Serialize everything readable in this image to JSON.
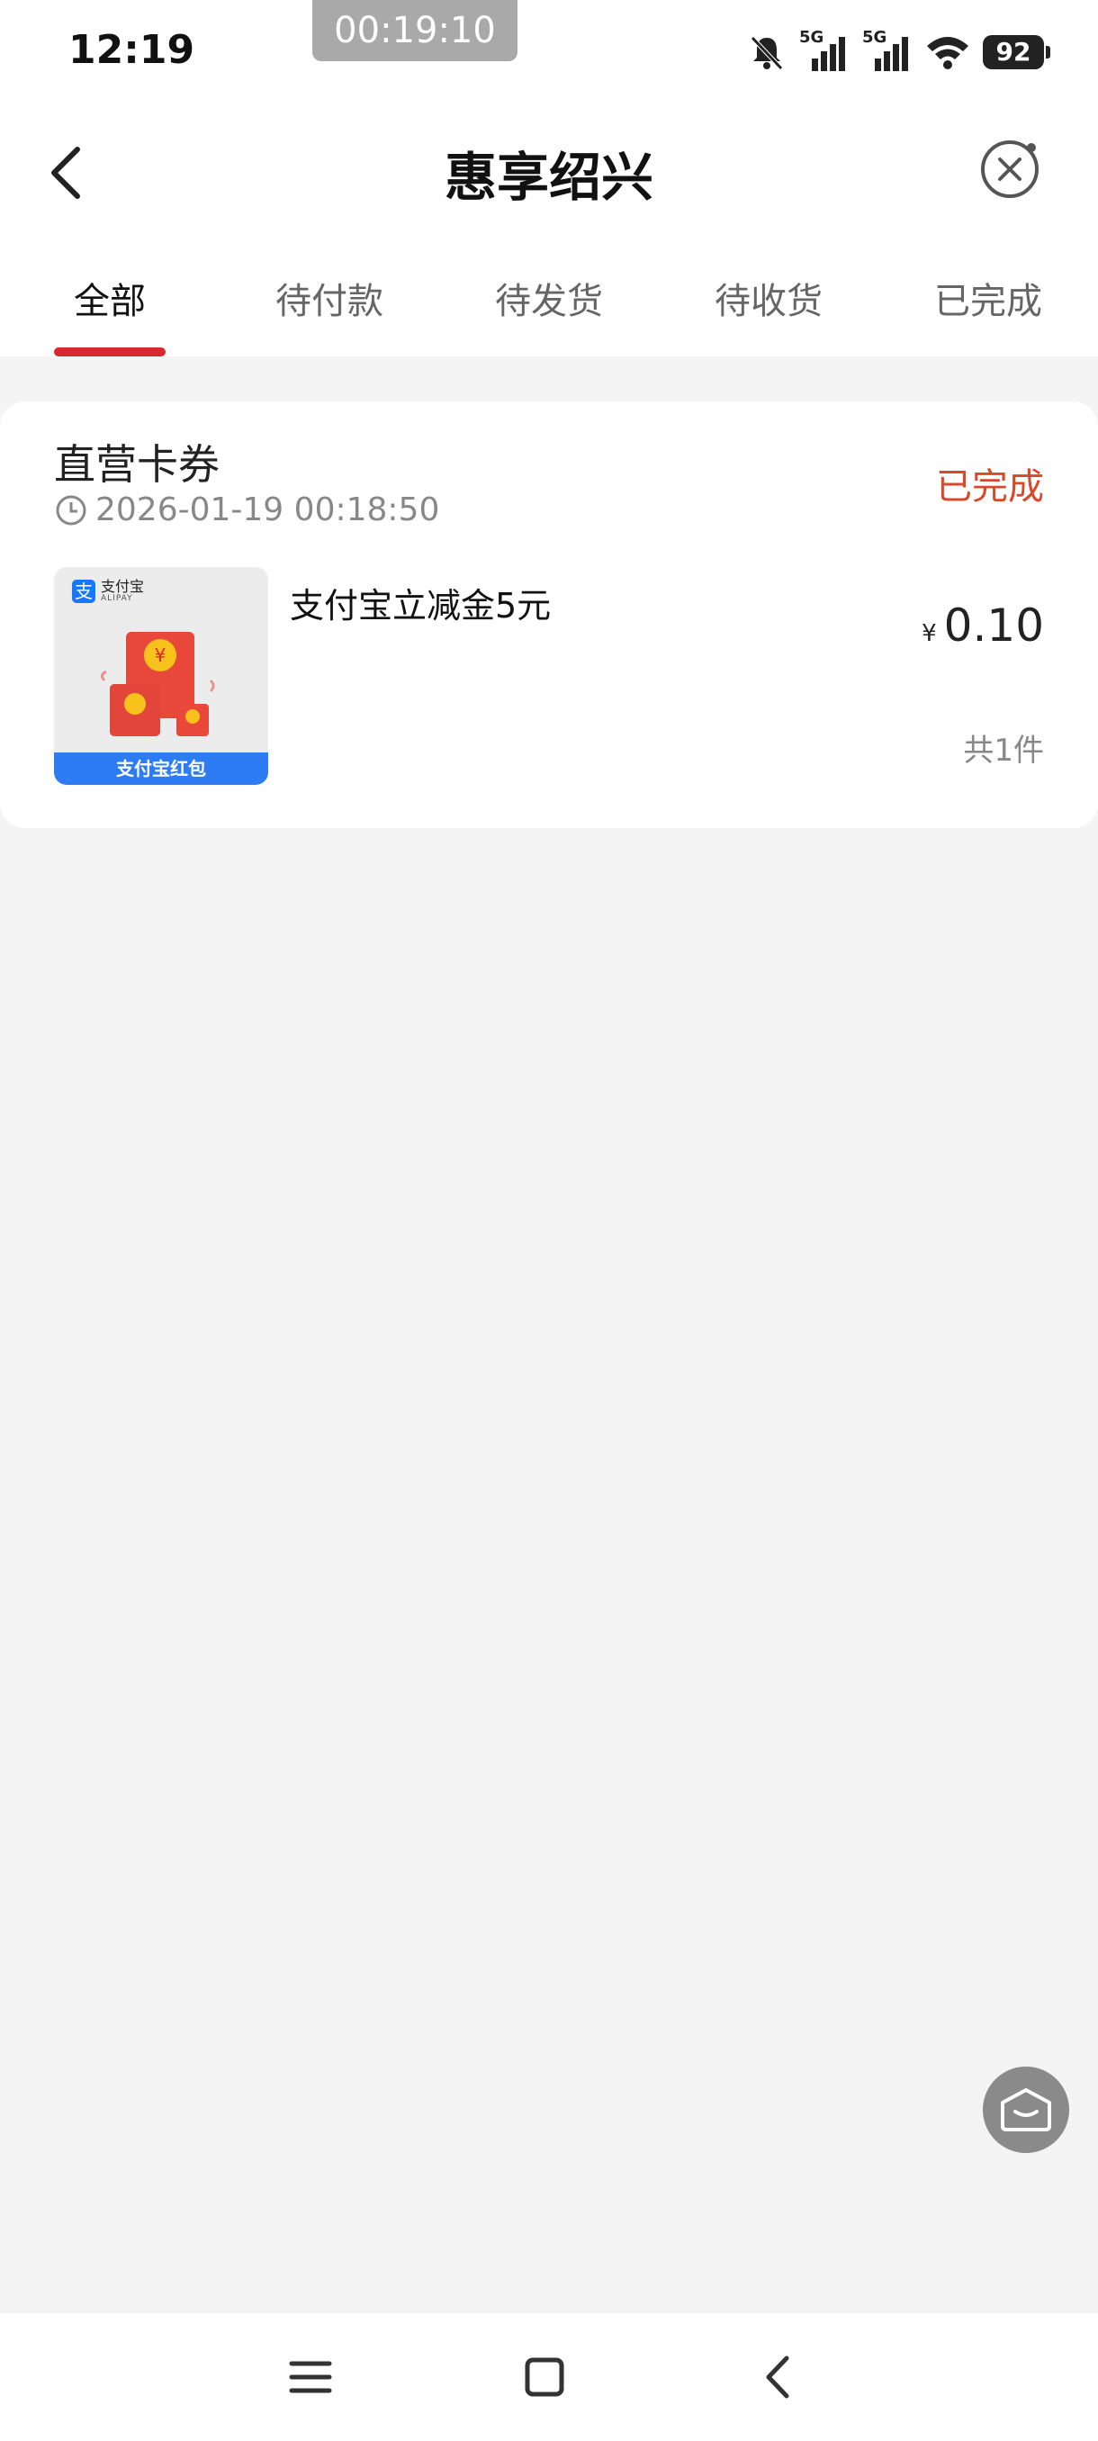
{
  "status_bar": {
    "time": "12:19",
    "recorder": "00:19:10",
    "battery": "92",
    "signal_label_1": "5G",
    "signal_label_2": "5G"
  },
  "header": {
    "title": "惠享绍兴",
    "back_icon": "back-chevron-icon",
    "close_icon": "close-circle-icon"
  },
  "tabs": [
    {
      "label": "全部",
      "active": true
    },
    {
      "label": "待付款",
      "active": false
    },
    {
      "label": "待发货",
      "active": false
    },
    {
      "label": "待收货",
      "active": false
    },
    {
      "label": "已完成",
      "active": false
    }
  ],
  "order": {
    "shop_name": "直营卡券",
    "time": "2026-01-19 00:18:50",
    "status": "已完成",
    "product_name": "支付宝立减金5元",
    "currency": "¥",
    "price": "0.10",
    "quantity": "共1件",
    "thumb": {
      "logo_text": "支付宝",
      "logo_sub": "ALIPAY",
      "logo_mark": "支",
      "footer": "支付宝红包"
    }
  },
  "colors": {
    "accent": "#d9282e",
    "status": "#d8482b",
    "background": "#f4f4f4"
  }
}
